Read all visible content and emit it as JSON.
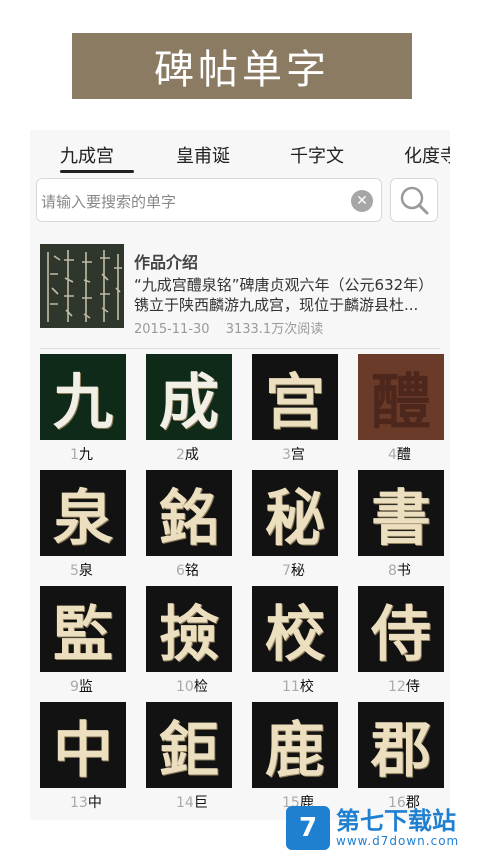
{
  "header": {
    "title": "碑帖单字"
  },
  "tabs": [
    {
      "label": "九成宫",
      "active": true
    },
    {
      "label": "皇甫诞"
    },
    {
      "label": "千字文"
    },
    {
      "label": "化度寺"
    }
  ],
  "search": {
    "placeholder": "请输入要搜索的单字",
    "value": ""
  },
  "intro": {
    "title": "作品介绍",
    "description": "“九成宫醴泉铭”碑唐贞观六年（公元632年）镌立于陕西麟游九成宫，现位于麟游县杜...",
    "date": "2015-11-30",
    "reads": "3133.1万次阅读"
  },
  "characters": [
    {
      "num": "1",
      "char": "九"
    },
    {
      "num": "2",
      "char": "成"
    },
    {
      "num": "3",
      "char": "宫"
    },
    {
      "num": "4",
      "char": "醴"
    },
    {
      "num": "5",
      "char": "泉"
    },
    {
      "num": "6",
      "char": "铭"
    },
    {
      "num": "7",
      "char": "秘"
    },
    {
      "num": "8",
      "char": "书"
    },
    {
      "num": "9",
      "char": "监"
    },
    {
      "num": "10",
      "char": "检"
    },
    {
      "num": "11",
      "char": "校"
    },
    {
      "num": "12",
      "char": "侍"
    },
    {
      "num": "13",
      "char": "中"
    },
    {
      "num": "14",
      "char": "巨"
    },
    {
      "num": "15",
      "char": "鹿"
    },
    {
      "num": "16",
      "char": "郡"
    }
  ],
  "tile_glyphs": [
    "九",
    "成",
    "宫",
    "醴",
    "泉",
    "銘",
    "秘",
    "書",
    "監",
    "撿",
    "校",
    "侍",
    "中",
    "鉅",
    "鹿",
    "郡"
  ],
  "watermark": {
    "name": "第七下载站",
    "url": "www.d7down.com",
    "logo": "7"
  },
  "colors": {
    "banner": "#8b7b62",
    "brand_blue": "#1f7fd0"
  }
}
